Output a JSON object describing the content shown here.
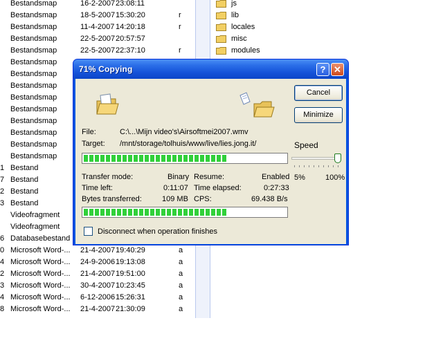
{
  "file_list": [
    {
      "lead": "",
      "name": "Bestandsmap",
      "date": "16-2-2007",
      "time": "23:08:11",
      "attr": ""
    },
    {
      "lead": "",
      "name": "Bestandsmap",
      "date": "18-5-2007",
      "time": "15:30:20",
      "attr": "r"
    },
    {
      "lead": "",
      "name": "Bestandsmap",
      "date": "11-4-2007",
      "time": "14:20:18",
      "attr": "r"
    },
    {
      "lead": "",
      "name": "Bestandsmap",
      "date": "22-5-2007",
      "time": "20:57:57",
      "attr": ""
    },
    {
      "lead": "",
      "name": "Bestandsmap",
      "date": "22-5-2007",
      "time": "22:37:10",
      "attr": "r"
    },
    {
      "lead": "",
      "name": "Bestandsmap",
      "date": "",
      "time": "",
      "attr": ""
    },
    {
      "lead": "",
      "name": "Bestandsmap",
      "date": "",
      "time": "",
      "attr": ""
    },
    {
      "lead": "",
      "name": "Bestandsmap",
      "date": "",
      "time": "",
      "attr": ""
    },
    {
      "lead": "",
      "name": "Bestandsmap",
      "date": "",
      "time": "",
      "attr": ""
    },
    {
      "lead": "",
      "name": "Bestandsmap",
      "date": "",
      "time": "",
      "attr": ""
    },
    {
      "lead": "",
      "name": "Bestandsmap",
      "date": "",
      "time": "",
      "attr": ""
    },
    {
      "lead": "",
      "name": "Bestandsmap",
      "date": "",
      "time": "",
      "attr": ""
    },
    {
      "lead": "",
      "name": "Bestandsmap",
      "date": "",
      "time": "",
      "attr": ""
    },
    {
      "lead": "",
      "name": "Bestandsmap",
      "date": "",
      "time": "",
      "attr": ""
    },
    {
      "lead": "1",
      "name": "Bestand",
      "date": "",
      "time": "",
      "attr": ""
    },
    {
      "lead": "7",
      "name": "Bestand",
      "date": "",
      "time": "",
      "attr": ""
    },
    {
      "lead": "2",
      "name": "Bestand",
      "date": "",
      "time": "",
      "attr": ""
    },
    {
      "lead": "3",
      "name": "Bestand",
      "date": "",
      "time": "",
      "attr": ""
    },
    {
      "lead": "",
      "name": "Videofragment",
      "date": "",
      "time": "",
      "attr": ""
    },
    {
      "lead": "",
      "name": "Videofragment",
      "date": "",
      "time": "",
      "attr": ""
    },
    {
      "lead": "6",
      "name": "Databasebestand",
      "date": "",
      "time": "",
      "attr": ""
    },
    {
      "lead": "0",
      "name": "Microsoft Word-...",
      "date": "21-4-2007",
      "time": "19:40:29",
      "attr": "a"
    },
    {
      "lead": "4",
      "name": "Microsoft Word-...",
      "date": "24-9-2006",
      "time": "19:13:08",
      "attr": "a"
    },
    {
      "lead": "2",
      "name": "Microsoft Word-...",
      "date": "21-4-2007",
      "time": "19:51:00",
      "attr": "a"
    },
    {
      "lead": "3",
      "name": "Microsoft Word-...",
      "date": "30-4-2007",
      "time": "10:23:45",
      "attr": "a"
    },
    {
      "lead": "4",
      "name": "Microsoft Word-...",
      "date": "6-12-2006",
      "time": "15:26:31",
      "attr": "a"
    },
    {
      "lead": "8",
      "name": "Microsoft Word-...",
      "date": "21-4-2007",
      "time": "21:30:09",
      "attr": "a"
    }
  ],
  "folders": [
    {
      "name": "js",
      "icon": "folder-icon"
    },
    {
      "name": "lib",
      "icon": "folder-icon"
    },
    {
      "name": "locales",
      "icon": "folder-icon"
    },
    {
      "name": "misc",
      "icon": "folder-icon"
    },
    {
      "name": "modules",
      "icon": "folder-icon"
    }
  ],
  "dialog": {
    "title": "71% Copying",
    "help_label": "?",
    "close_label": "✕",
    "cancel_label": "Cancel",
    "minimize_label": "Minimize",
    "file_label": "File:",
    "file_value": "C:\\...\\Mijn video's\\Airsoftmei2007.wmv",
    "target_label": "Target:",
    "target_value": "/mnt/storage/tolhuis/www/live/lies.jong.it/",
    "file_progress": 0.71,
    "speed_label": "Speed",
    "speed_min": "5%",
    "speed_max": "100%",
    "speed_level": 1.0,
    "transfer_mode_label": "Transfer mode:",
    "transfer_mode_value": "Binary",
    "resume_label": "Resume:",
    "resume_value": "Enabled",
    "time_left_label": "Time left:",
    "time_left_value": "0:11:07",
    "time_elapsed_label": "Time elapsed:",
    "time_elapsed_value": "0:27:33",
    "bytes_label": "Bytes transferred:",
    "bytes_value": "109 MB",
    "cps_label": "CPS:",
    "cps_value": "69.438 B/s",
    "total_progress": 0.71,
    "disconnect_label": "Disconnect when operation finishes",
    "disconnect_checked": false
  },
  "colors": {
    "titlebar": "#0b45c8",
    "progress_fill": "#31d03a",
    "dialog_face": "#ece9d8"
  }
}
